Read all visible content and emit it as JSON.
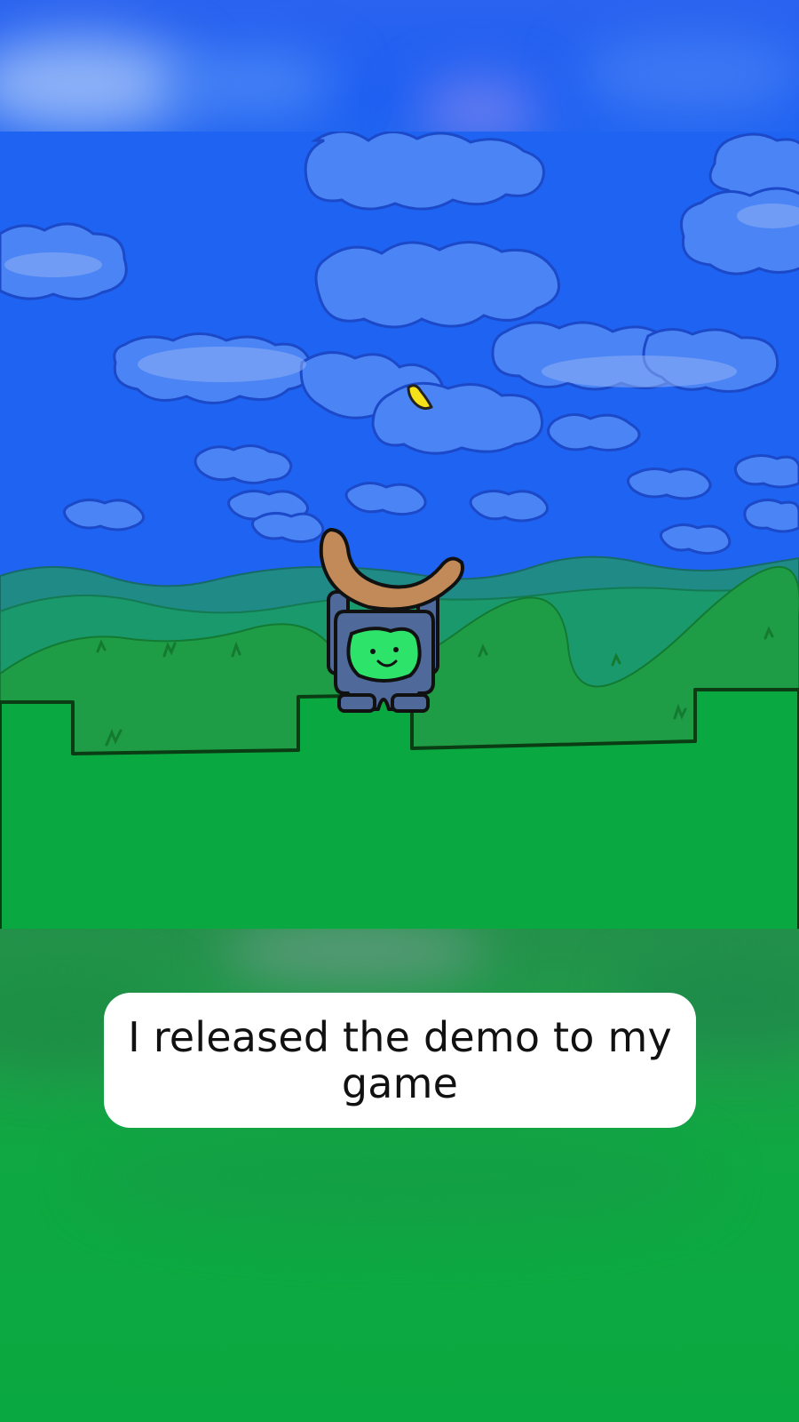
{
  "caption": {
    "text": "I released the demo to my game"
  },
  "scene": {
    "sky_color": "#1f63f2",
    "cloud_color": "#4b84f5",
    "far_hills_color": "#1f8a7a",
    "mid_hills_color": "#1a9a6a",
    "near_hills_color": "#20a04a",
    "ground_color": "#0aa840",
    "character": {
      "name": "character-with-boomerang-hat",
      "body_color": "#4f6a9a",
      "face_color": "#2ee36a",
      "hat_color": "#c28a58"
    },
    "collectible": {
      "name": "yellow-leaf",
      "color": "#f5e11a"
    }
  }
}
